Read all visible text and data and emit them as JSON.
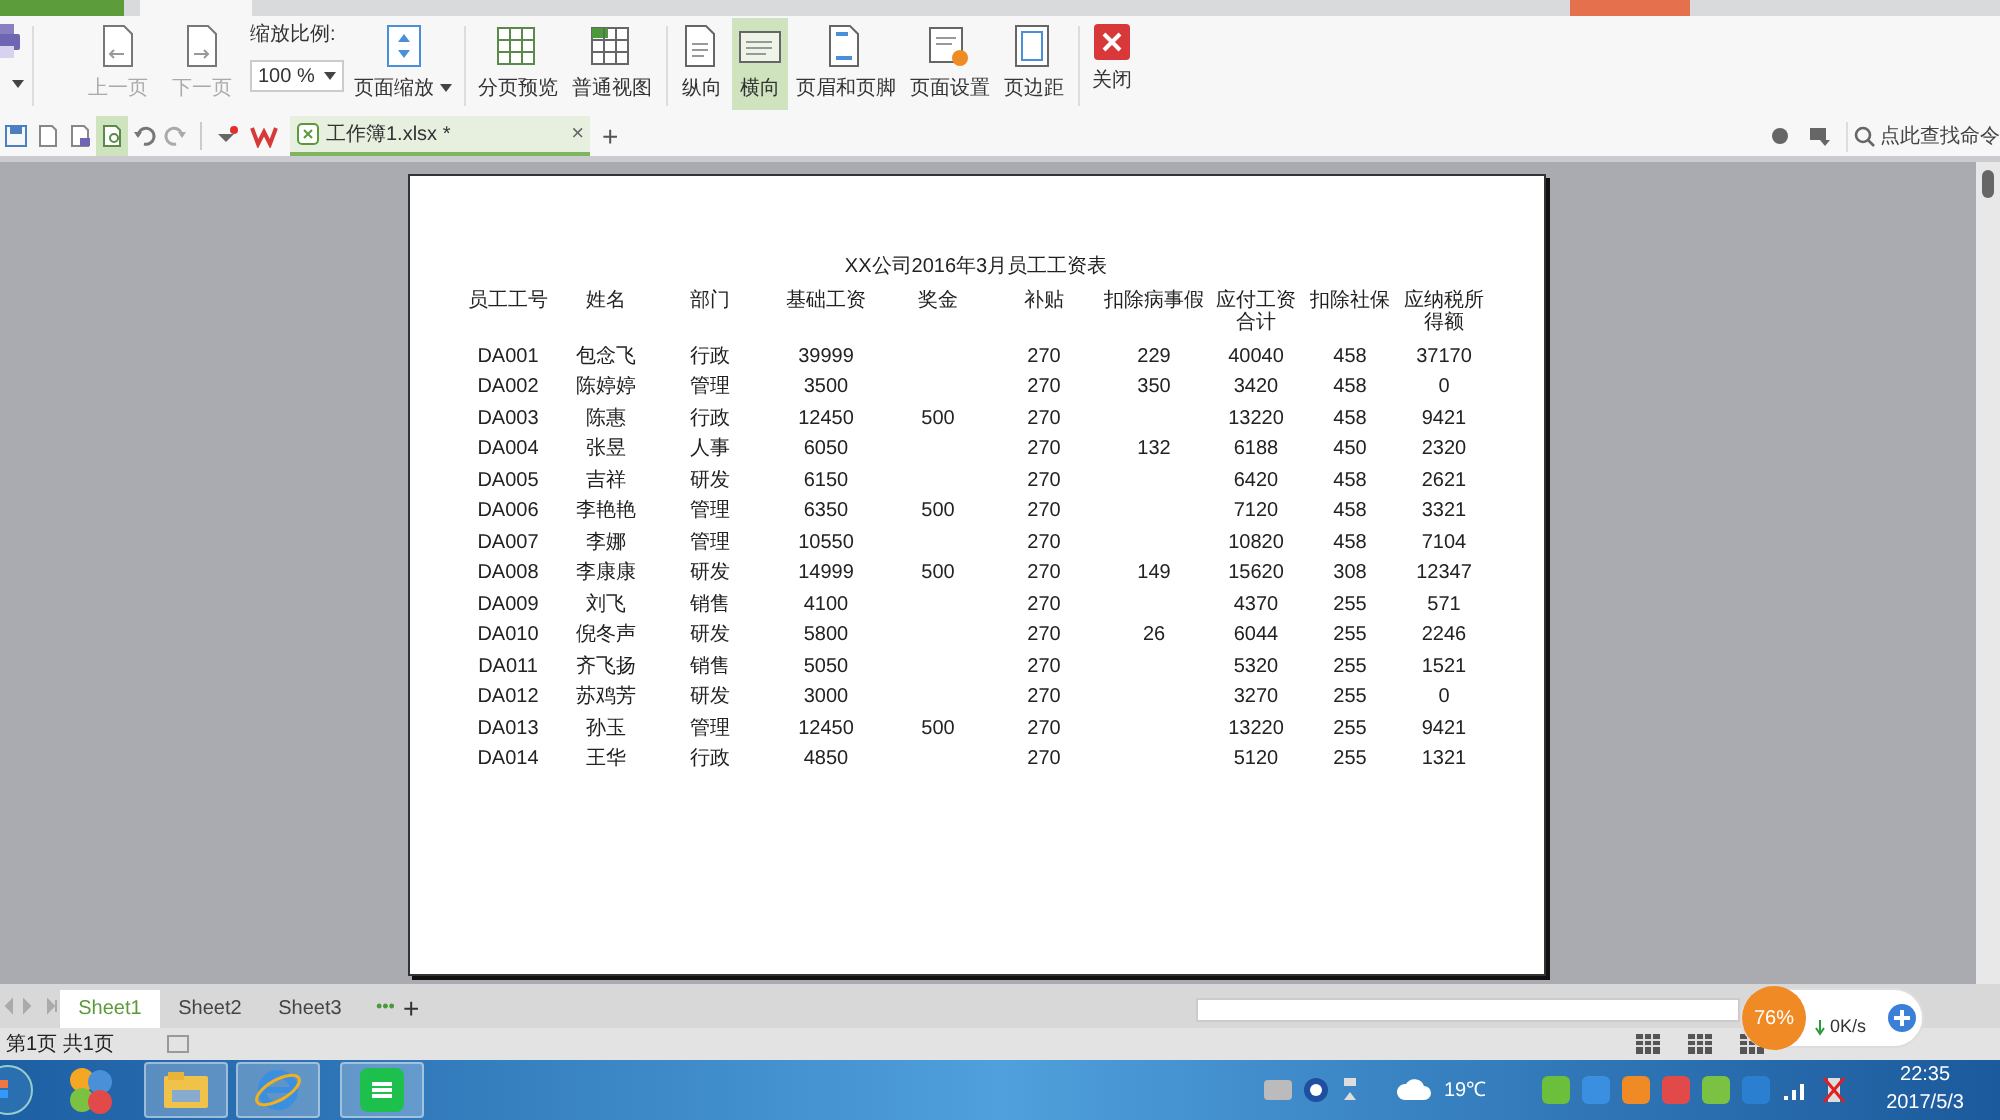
{
  "toolbar": {
    "buttons": [
      {
        "label": "上一页",
        "disabled": true,
        "selected": false
      },
      {
        "label": "下一页",
        "disabled": true,
        "selected": false
      }
    ],
    "zoom_label": "缩放比例:",
    "zoom_value": "100 %",
    "zoom_menu": "页面缩放",
    "views": [
      {
        "label": "分页预览",
        "selected": false
      },
      {
        "label": "普通视图",
        "selected": false
      },
      {
        "label": "纵向",
        "selected": false
      },
      {
        "label": "横向",
        "selected": true
      },
      {
        "label": "页眉和页脚",
        "selected": false
      },
      {
        "label": "页面设置",
        "selected": false
      },
      {
        "label": "页边距",
        "selected": false
      }
    ],
    "close": "关闭"
  },
  "doc_tab": {
    "title": "工作簿1.xlsx *",
    "close": "×",
    "add": "+"
  },
  "search": {
    "placeholder": "点此查找命令"
  },
  "sheet": {
    "title": "XX公司2016年3月员工工资表",
    "columns": [
      "员工工号",
      "姓名",
      "部门",
      "基础工资",
      "奖金",
      "补贴",
      "扣除病事假",
      "应付工资合计",
      "扣除社保",
      "应纳税所得额"
    ],
    "rows": [
      [
        "DA001",
        "包念飞",
        "行政",
        "39999",
        "",
        "270",
        "229",
        "40040",
        "458",
        "37170"
      ],
      [
        "DA002",
        "陈婷婷",
        "管理",
        "3500",
        "",
        "270",
        "350",
        "3420",
        "458",
        "0"
      ],
      [
        "DA003",
        "陈惠",
        "行政",
        "12450",
        "500",
        "270",
        "",
        "13220",
        "458",
        "9421"
      ],
      [
        "DA004",
        "张昱",
        "人事",
        "6050",
        "",
        "270",
        "132",
        "6188",
        "450",
        "2320"
      ],
      [
        "DA005",
        "吉祥",
        "研发",
        "6150",
        "",
        "270",
        "",
        "6420",
        "458",
        "2621"
      ],
      [
        "DA006",
        "李艳艳",
        "管理",
        "6350",
        "500",
        "270",
        "",
        "7120",
        "458",
        "3321"
      ],
      [
        "DA007",
        "李娜",
        "管理",
        "10550",
        "",
        "270",
        "",
        "10820",
        "458",
        "7104"
      ],
      [
        "DA008",
        "李康康",
        "研发",
        "14999",
        "500",
        "270",
        "149",
        "15620",
        "308",
        "12347"
      ],
      [
        "DA009",
        "刘飞",
        "销售",
        "4100",
        "",
        "270",
        "",
        "4370",
        "255",
        "571"
      ],
      [
        "DA010",
        "倪冬声",
        "研发",
        "5800",
        "",
        "270",
        "26",
        "6044",
        "255",
        "2246"
      ],
      [
        "DA011",
        "齐飞扬",
        "销售",
        "5050",
        "",
        "270",
        "",
        "5320",
        "255",
        "1521"
      ],
      [
        "DA012",
        "苏鸡芳",
        "研发",
        "3000",
        "",
        "270",
        "",
        "3270",
        "255",
        "0"
      ],
      [
        "DA013",
        "孙玉",
        "管理",
        "12450",
        "500",
        "270",
        "",
        "13220",
        "255",
        "9421"
      ],
      [
        "DA014",
        "王华",
        "行政",
        "4850",
        "",
        "270",
        "",
        "5120",
        "255",
        "1321"
      ]
    ]
  },
  "sheet_tabs": [
    {
      "label": "Sheet1",
      "selected": true
    },
    {
      "label": "Sheet2",
      "selected": false
    },
    {
      "label": "Sheet3",
      "selected": false
    }
  ],
  "sheet_more": "•••",
  "sheet_add": "+",
  "status_bar": {
    "page_info": "第1页 共1页"
  },
  "speed_widget": {
    "percent": "76%",
    "download": "0K/s"
  },
  "taskbar": {
    "temperature": "19℃",
    "time": "22:35",
    "date": "2017/5/3"
  }
}
